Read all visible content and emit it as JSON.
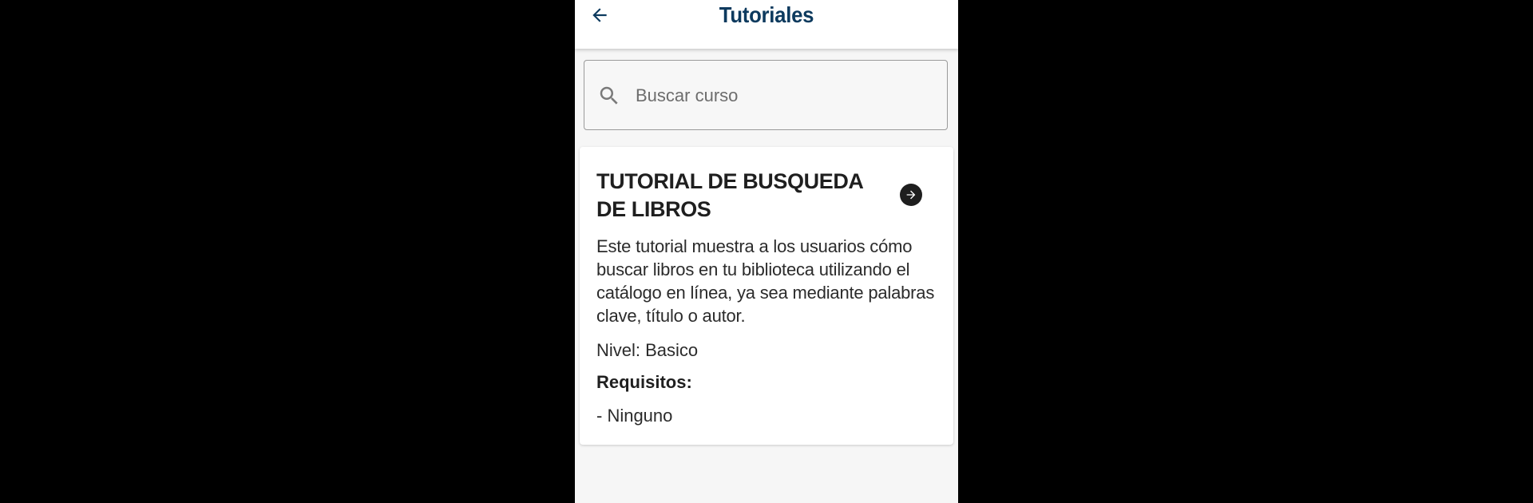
{
  "header": {
    "title": "Tutoriales",
    "back_icon": "arrow-left-icon",
    "title_color": "#0d3a5e"
  },
  "search": {
    "placeholder": "Buscar curso",
    "value": "",
    "icon": "search-icon"
  },
  "course": {
    "title": "TUTORIAL DE BUSQUEDA DE LIBROS",
    "description": "Este tutorial muestra a los usuarios cómo buscar libros en tu biblioteca utilizando el catálogo en línea, ya sea mediante palabras clave, título o autor.",
    "level": "Nivel: Basico",
    "requirements_label": "Requisitos:",
    "requirements": [
      "- Ninguno"
    ],
    "open_icon": "arrow-right-circle-icon"
  },
  "colors": {
    "background": "#000000",
    "screen": "#f6f6f6",
    "card": "#ffffff"
  }
}
